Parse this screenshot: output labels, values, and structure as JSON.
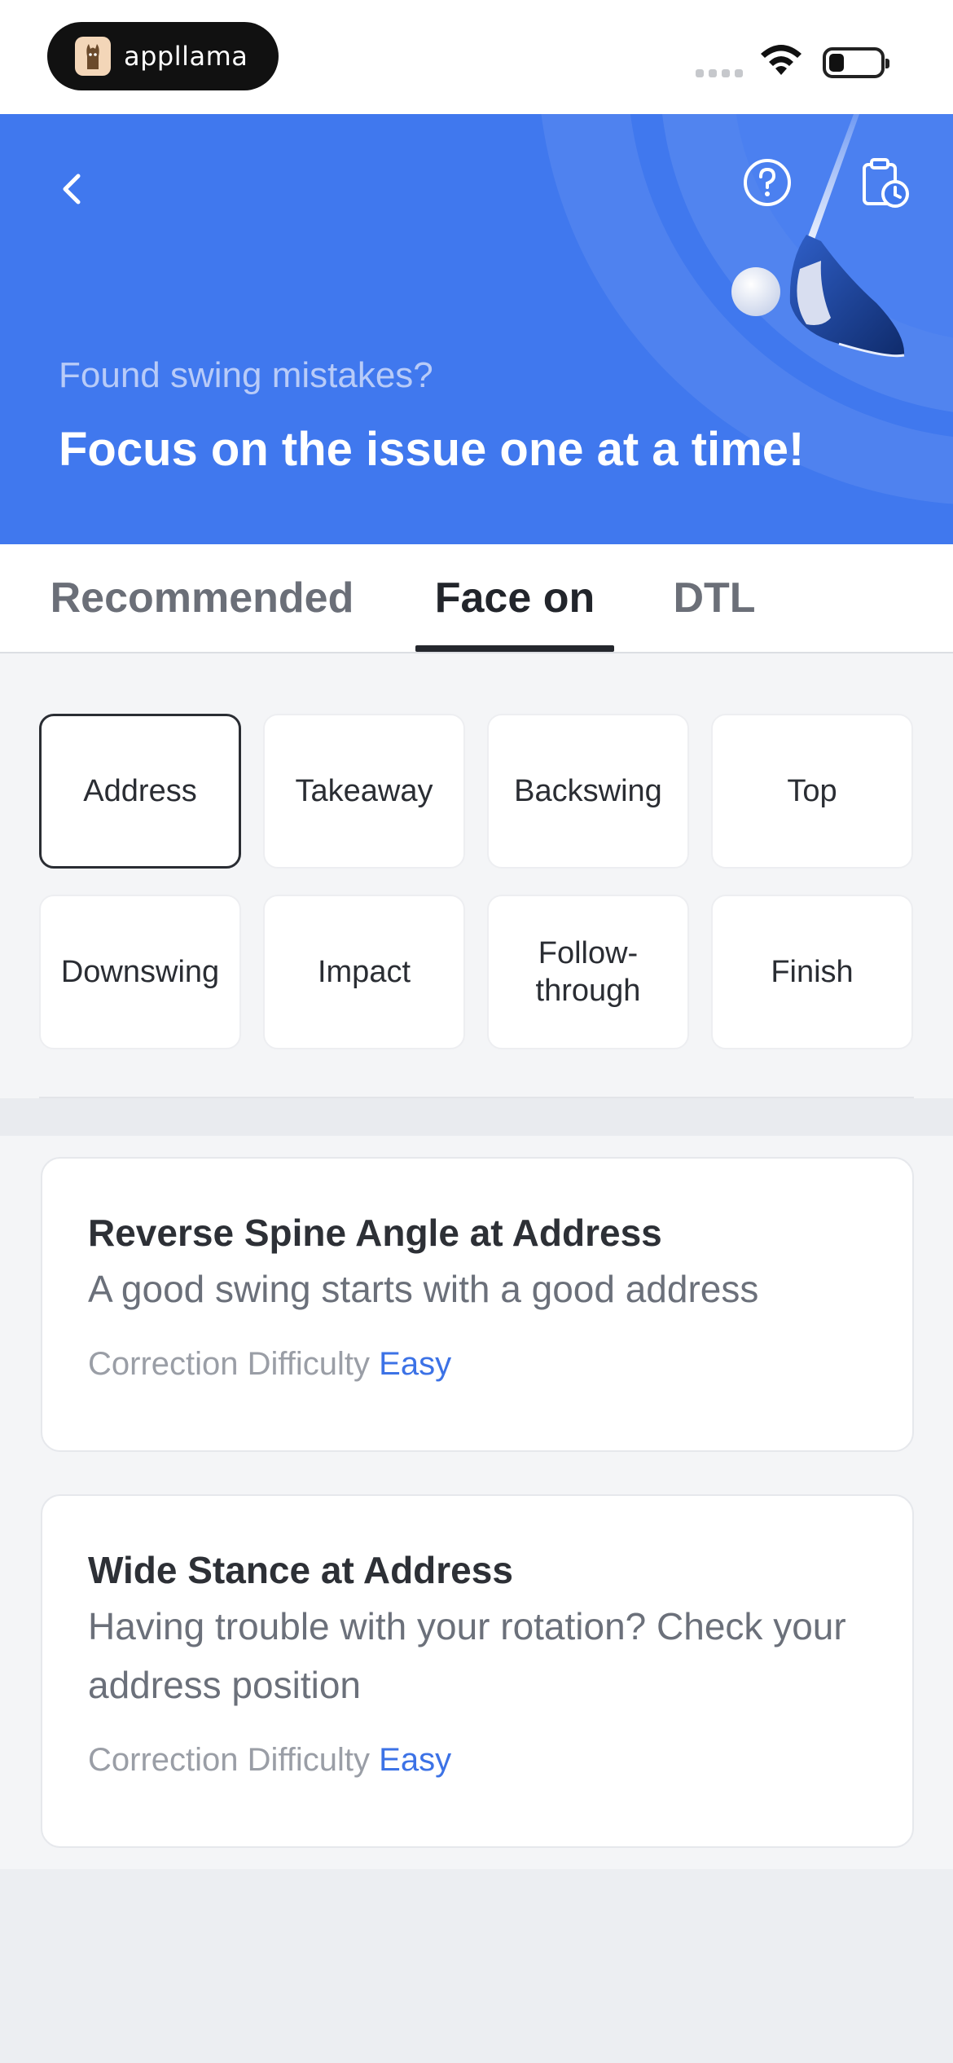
{
  "status_bar": {
    "app_badge": "appllama"
  },
  "hero": {
    "subtitle": "Found swing mistakes?",
    "title": "Focus on the issue one at a time!"
  },
  "tabs": [
    {
      "label": "Recommended",
      "active": false
    },
    {
      "label": "Face on",
      "active": true
    },
    {
      "label": "DTL",
      "active": false
    }
  ],
  "phases": [
    {
      "label": "Address",
      "selected": true
    },
    {
      "label": "Takeaway",
      "selected": false
    },
    {
      "label": "Backswing",
      "selected": false
    },
    {
      "label": "Top",
      "selected": false
    },
    {
      "label": "Downswing",
      "selected": false
    },
    {
      "label": "Impact",
      "selected": false
    },
    {
      "label": "Follow-\nthrough",
      "selected": false
    },
    {
      "label": "Finish",
      "selected": false
    }
  ],
  "mistakes": [
    {
      "title": "Reverse Spine Angle at Address",
      "description": "A good swing starts with a good address",
      "difficulty_label": "Correction Difficulty",
      "difficulty_value": "Easy"
    },
    {
      "title": "Wide Stance at Address",
      "description": "Having trouble with your rotation? Check your address position",
      "difficulty_label": "Correction Difficulty",
      "difficulty_value": "Easy"
    }
  ],
  "colors": {
    "hero_bg": "#4078ee",
    "accent": "#3c72e6",
    "page_bg": "#f4f5f7"
  },
  "icons": [
    "back-icon",
    "help-icon",
    "history-icon",
    "golf-club-illustration",
    "wifi-icon",
    "battery-icon"
  ]
}
